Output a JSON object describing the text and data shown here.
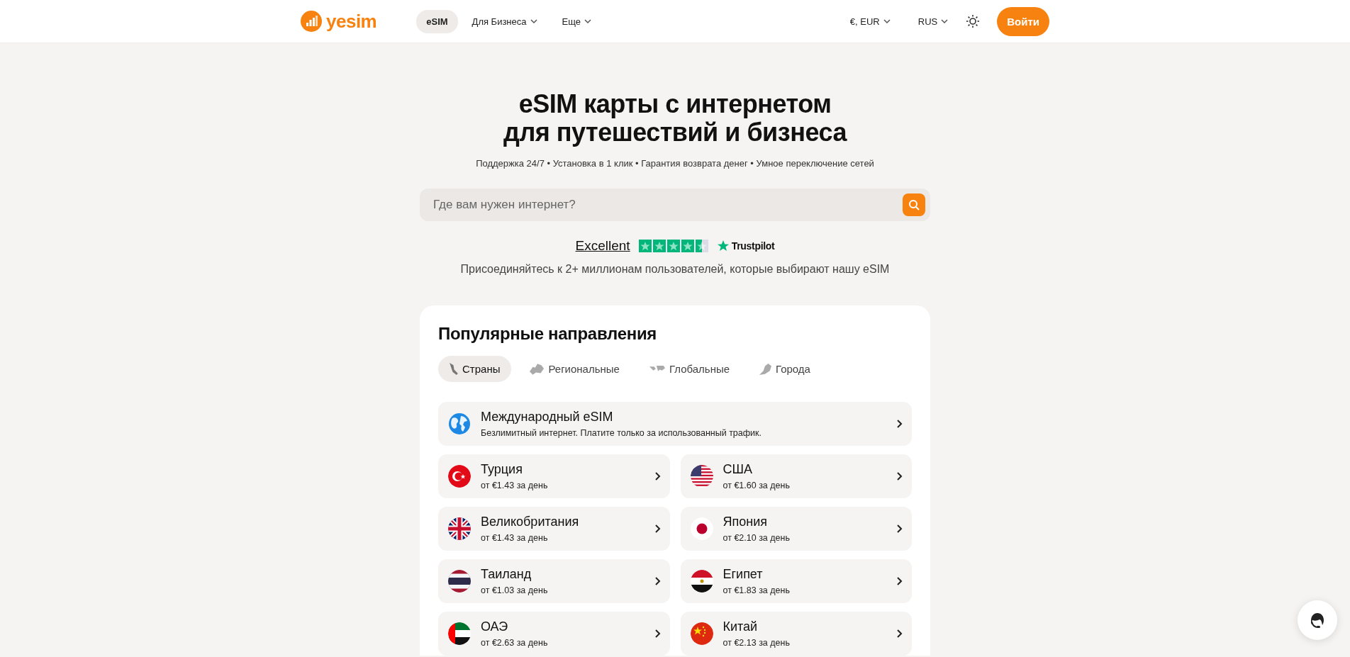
{
  "header": {
    "logo": "yesim",
    "nav": [
      {
        "label": "eSIM",
        "selected": true,
        "dropdown": false
      },
      {
        "label": "Для Бизнеса",
        "selected": false,
        "dropdown": true
      },
      {
        "label": "Еще",
        "selected": false,
        "dropdown": true
      }
    ],
    "currency": "€, EUR",
    "language": "RUS",
    "login": "Войти"
  },
  "hero": {
    "title_lines": [
      "eSIM карты с интернетом",
      "для путешествий и бизнеса"
    ],
    "features": "Поддержка 24/7 • Установка в 1 клик • Гарантия возврата денег • Умное переключение сетей",
    "search": {
      "placeholder": "Где вам нужен интернет?"
    },
    "rating": {
      "label": "Excellent",
      "stars": 4.5,
      "brand": "Trustpilot"
    },
    "join_text": "Присоединяйтесь к 2+ миллионам пользователей, которые выбирают нашу eSIM"
  },
  "destinations": {
    "title": "Популярные направления",
    "tabs": [
      {
        "label": "Страны",
        "selected": true
      },
      {
        "label": "Региональные",
        "selected": false
      },
      {
        "label": "Глобальные",
        "selected": false
      },
      {
        "label": "Города",
        "selected": false
      }
    ],
    "featured": {
      "name": "Международный eSIM",
      "description": "Безлимитный интернет. Платите только за использованный трафик."
    },
    "countries": [
      {
        "name": "Турция",
        "price": "от €1.43 за день"
      },
      {
        "name": "США",
        "price": "от €1.60 за день"
      },
      {
        "name": "Великобритания",
        "price": "от €1.43 за день"
      },
      {
        "name": "Япония",
        "price": "от €2.10 за день"
      },
      {
        "name": "Таиланд",
        "price": "от €1.03 за день"
      },
      {
        "name": "Египет",
        "price": "от €1.83 за день"
      },
      {
        "name": "ОАЭ",
        "price": "от €2.63 за день"
      },
      {
        "name": "Китай",
        "price": "от €2.13 за день"
      }
    ]
  }
}
